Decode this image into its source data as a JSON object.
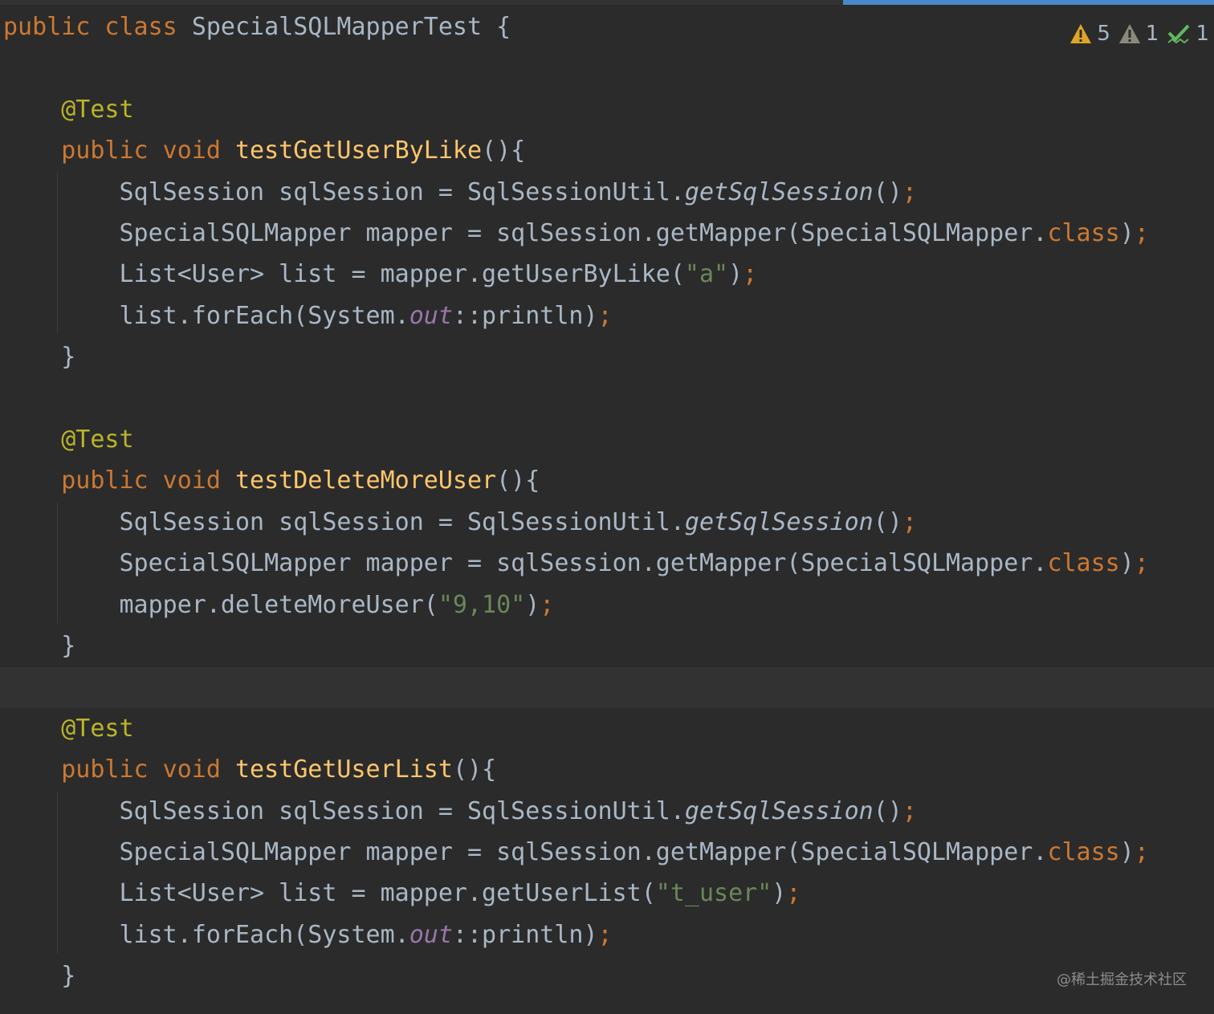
{
  "editor": {
    "indicators": {
      "warnings_count": "5",
      "weak_warnings_count": "1",
      "ok_count": "1"
    },
    "watermark": "@稀土掘金技术社区",
    "colors": {
      "background": "#2b2b2b",
      "keyword": "#cc7832",
      "annotation": "#bbb529",
      "method_declaration": "#ffc66d",
      "string": "#6a8759",
      "static_field": "#9876aa",
      "default_text": "#a9b7c6"
    },
    "lines": [
      [
        {
          "cls": "kw",
          "text": "public class "
        },
        {
          "cls": "",
          "text": "SpecialSQLMapperTest {"
        }
      ],
      [],
      [
        {
          "cls": "",
          "text": "    "
        },
        {
          "cls": "ann",
          "text": "@Test"
        }
      ],
      [
        {
          "cls": "",
          "text": "    "
        },
        {
          "cls": "kw",
          "text": "public void "
        },
        {
          "cls": "fn",
          "text": "testGetUserByLike"
        },
        {
          "cls": "",
          "text": "(){"
        }
      ],
      [
        {
          "cls": "",
          "text": "        SqlSession sqlSession = SqlSessionUtil."
        },
        {
          "cls": "it",
          "text": "getSqlSession"
        },
        {
          "cls": "",
          "text": "()"
        },
        {
          "cls": "kw",
          "text": ";"
        }
      ],
      [
        {
          "cls": "",
          "text": "        SpecialSQLMapper mapper = sqlSession.getMapper(SpecialSQLMapper."
        },
        {
          "cls": "kw",
          "text": "class"
        },
        {
          "cls": "",
          "text": ")"
        },
        {
          "cls": "kw",
          "text": ";"
        }
      ],
      [
        {
          "cls": "",
          "text": "        List<User> list = mapper.getUserByLike("
        },
        {
          "cls": "str",
          "text": "\"a\""
        },
        {
          "cls": "",
          "text": ")"
        },
        {
          "cls": "kw",
          "text": ";"
        }
      ],
      [
        {
          "cls": "",
          "text": "        list.forEach(System."
        },
        {
          "cls": "fld",
          "text": "out"
        },
        {
          "cls": "",
          "text": "::println)"
        },
        {
          "cls": "kw",
          "text": ";"
        }
      ],
      [
        {
          "cls": "",
          "text": "    }"
        }
      ],
      [],
      [
        {
          "cls": "",
          "text": "    "
        },
        {
          "cls": "ann",
          "text": "@Test"
        }
      ],
      [
        {
          "cls": "",
          "text": "    "
        },
        {
          "cls": "kw",
          "text": "public void "
        },
        {
          "cls": "fn",
          "text": "testDeleteMoreUser"
        },
        {
          "cls": "",
          "text": "(){"
        }
      ],
      [
        {
          "cls": "",
          "text": "        SqlSession sqlSession = SqlSessionUtil."
        },
        {
          "cls": "it",
          "text": "getSqlSession"
        },
        {
          "cls": "",
          "text": "()"
        },
        {
          "cls": "kw",
          "text": ";"
        }
      ],
      [
        {
          "cls": "",
          "text": "        SpecialSQLMapper mapper = sqlSession.getMapper(SpecialSQLMapper."
        },
        {
          "cls": "kw",
          "text": "class"
        },
        {
          "cls": "",
          "text": ")"
        },
        {
          "cls": "kw",
          "text": ";"
        }
      ],
      [
        {
          "cls": "",
          "text": "        mapper.deleteMoreUser("
        },
        {
          "cls": "str",
          "text": "\"9,10\""
        },
        {
          "cls": "",
          "text": ")"
        },
        {
          "cls": "kw",
          "text": ";"
        }
      ],
      [
        {
          "cls": "",
          "text": "    }"
        }
      ],
      [],
      [
        {
          "cls": "",
          "text": "    "
        },
        {
          "cls": "ann",
          "text": "@Test"
        }
      ],
      [
        {
          "cls": "",
          "text": "    "
        },
        {
          "cls": "kw",
          "text": "public void "
        },
        {
          "cls": "fn",
          "text": "testGetUserList"
        },
        {
          "cls": "",
          "text": "(){"
        }
      ],
      [
        {
          "cls": "",
          "text": "        SqlSession sqlSession = SqlSessionUtil."
        },
        {
          "cls": "it",
          "text": "getSqlSession"
        },
        {
          "cls": "",
          "text": "()"
        },
        {
          "cls": "kw",
          "text": ";"
        }
      ],
      [
        {
          "cls": "",
          "text": "        SpecialSQLMapper mapper = sqlSession.getMapper(SpecialSQLMapper."
        },
        {
          "cls": "kw",
          "text": "class"
        },
        {
          "cls": "",
          "text": ")"
        },
        {
          "cls": "kw",
          "text": ";"
        }
      ],
      [
        {
          "cls": "",
          "text": "        List<User> list = mapper.getUserList("
        },
        {
          "cls": "str",
          "text": "\"t_user\""
        },
        {
          "cls": "",
          "text": ")"
        },
        {
          "cls": "kw",
          "text": ";"
        }
      ],
      [
        {
          "cls": "",
          "text": "        list.forEach(System."
        },
        {
          "cls": "fld",
          "text": "out"
        },
        {
          "cls": "",
          "text": "::println)"
        },
        {
          "cls": "kw",
          "text": ";"
        }
      ],
      [
        {
          "cls": "",
          "text": "    }"
        }
      ]
    ]
  }
}
